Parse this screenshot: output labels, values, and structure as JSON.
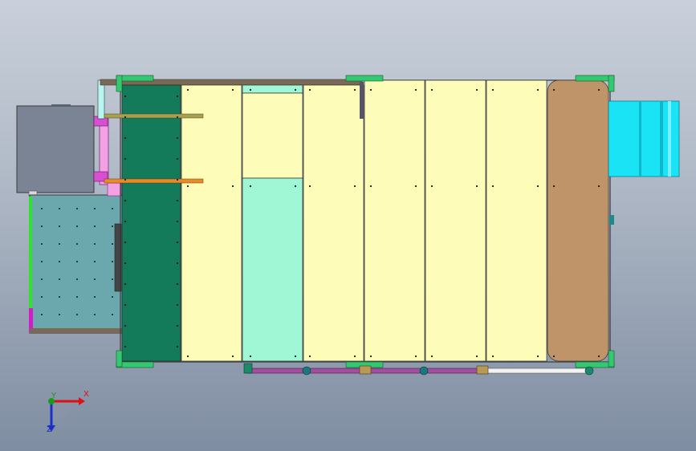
{
  "viewport": {
    "background": [
      "#c9d0db",
      "#7f8da2"
    ]
  },
  "model": {
    "colors": {
      "frame_outline": "#4a4a4a",
      "top_rail": "#7a6a55",
      "green_panel": "#137a5a",
      "yellow_panel": "#fdfcb8",
      "mint_panel": "#9ff7d5",
      "brown_panel": "#bf9468",
      "cyan_unit": "#19e3f5",
      "teal_box": "#6ba8ad",
      "gray_box": "#7a8494",
      "magenta_pipe": "#a24fa0",
      "orange_rod": "#ea8b2a",
      "olive_rod": "#a9a04d",
      "bracket_green": "#35c872",
      "pink_pipe": "#f3a1e2",
      "white_pipe": "#f2f2f2"
    }
  },
  "triad": {
    "x_label": "X",
    "y_label": "Y",
    "z_label": "Z"
  }
}
